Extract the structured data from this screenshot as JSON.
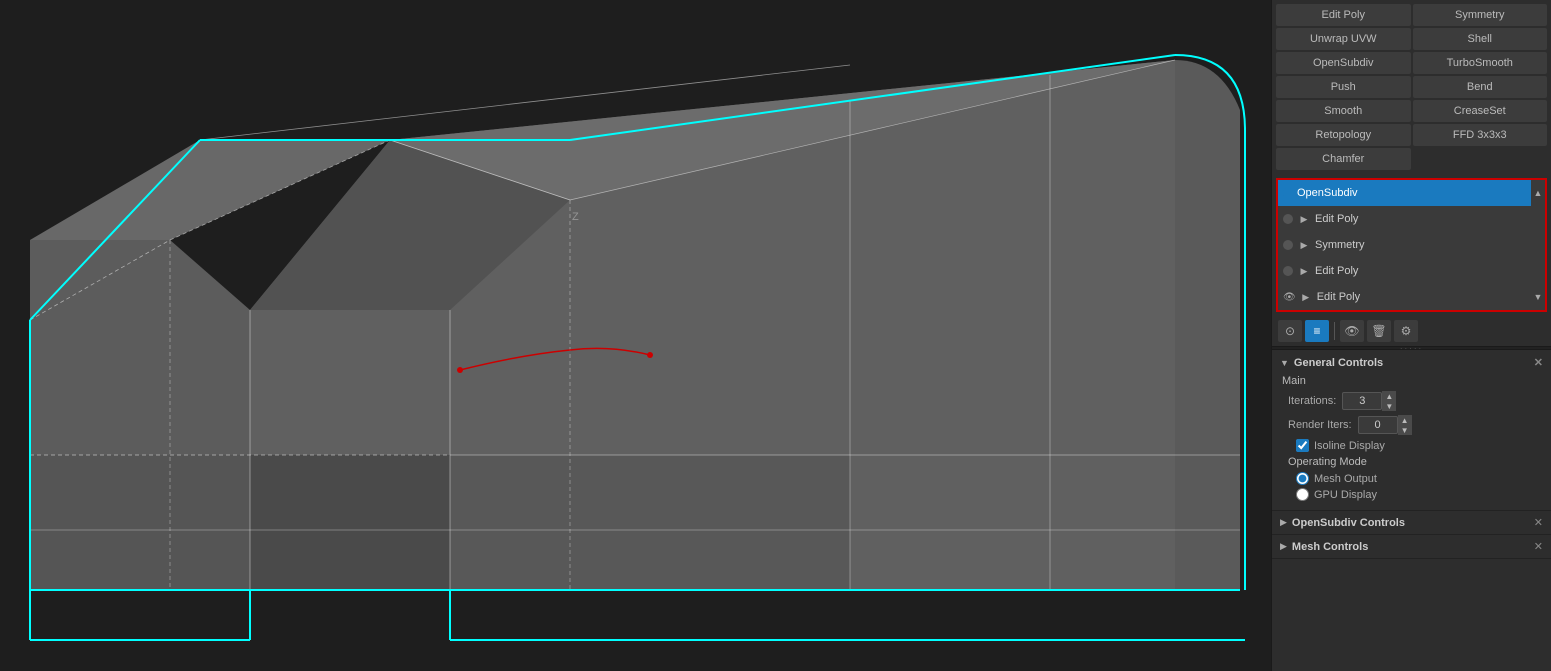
{
  "viewport": {
    "background": "#2a2a2a"
  },
  "right_panel": {
    "modifier_buttons": [
      {
        "label": "Edit Poly",
        "col": 1
      },
      {
        "label": "Symmetry",
        "col": 2
      },
      {
        "label": "Unwrap UVW",
        "col": 1
      },
      {
        "label": "Shell",
        "col": 2
      },
      {
        "label": "OpenSubdiv",
        "col": 1
      },
      {
        "label": "TurboSmooth",
        "col": 2
      },
      {
        "label": "Push",
        "col": 1
      },
      {
        "label": "Bend",
        "col": 2
      },
      {
        "label": "Smooth",
        "col": 1
      },
      {
        "label": "CreaseSet",
        "col": 2
      },
      {
        "label": "Retopology",
        "col": 1
      },
      {
        "label": "FFD 3x3x3",
        "col": 2
      },
      {
        "label": "Chamfer",
        "col": 1
      }
    ],
    "modifier_stack": [
      {
        "name": "OpenSubdiv",
        "active": true,
        "has_eye": true,
        "has_arrow": false
      },
      {
        "name": "Edit Poly",
        "active": false,
        "has_eye": true,
        "has_arrow": true
      },
      {
        "name": "Symmetry",
        "active": false,
        "has_eye": true,
        "has_arrow": true
      },
      {
        "name": "Edit Poly",
        "active": false,
        "has_eye": true,
        "has_arrow": true
      },
      {
        "name": "Edit Poly",
        "active": false,
        "has_eye": true,
        "has_arrow": true
      }
    ],
    "stack_toolbar": {
      "buttons": [
        {
          "icon": "⊙",
          "label": "pin",
          "active": false
        },
        {
          "icon": "≡",
          "label": "list",
          "active": true
        },
        {
          "icon": "👁",
          "label": "eye",
          "active": false
        },
        {
          "icon": "🗑",
          "label": "delete",
          "active": false
        },
        {
          "icon": "✎",
          "label": "edit",
          "active": false
        }
      ]
    },
    "general_controls": {
      "header": "General Controls",
      "main_label": "Main",
      "iterations_label": "Iterations:",
      "iterations_value": "3",
      "render_iters_label": "Render Iters:",
      "render_iters_value": "0",
      "isoline_display_label": "Isoline Display",
      "isoline_checked": true,
      "operating_mode_label": "Operating Mode",
      "mesh_output_label": "Mesh Output",
      "gpu_display_label": "GPU Display",
      "mesh_output_checked": true,
      "gpu_display_checked": false
    },
    "opensubdiv_controls": {
      "header": "OpenSubdiv Controls"
    },
    "mesh_controls": {
      "header": "Mesh Controls"
    }
  }
}
